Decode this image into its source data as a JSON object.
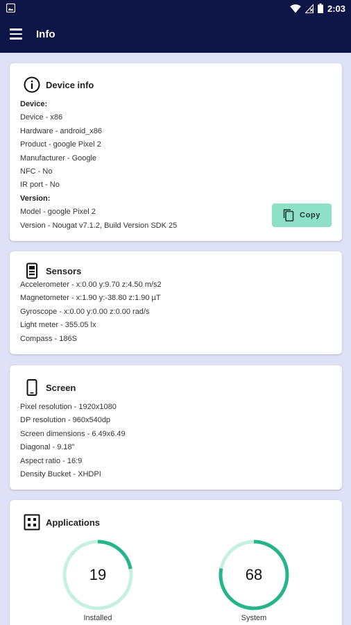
{
  "status_bar": {
    "time": "2:03"
  },
  "app_bar": {
    "title": "Info"
  },
  "device_info": {
    "title": "Device info",
    "lines": [
      {
        "text": "Device:",
        "bold": true
      },
      {
        "text": "Device - x86",
        "bold": false
      },
      {
        "text": "Hardware - android_x86",
        "bold": false
      },
      {
        "text": "Product - google Pixel 2",
        "bold": false
      },
      {
        "text": "Manufacturer - Google",
        "bold": false
      },
      {
        "text": "NFC - No",
        "bold": false
      },
      {
        "text": "IR port - No",
        "bold": false
      },
      {
        "text": "Version:",
        "bold": true
      },
      {
        "text": "Model - google Pixel 2",
        "bold": false
      },
      {
        "text": "Version - Nougat v7.1.2, Build Version SDK 25",
        "bold": false
      }
    ],
    "copy_label": "Copy"
  },
  "sensors": {
    "title": "Sensors",
    "lines": [
      "Accelerometer - x:0.00 y:9.70 z:4.50 m/s2",
      "Magnetometer - x:1.90 y:-38.80 z:1.90 µT",
      "Gyroscope - x:0.00 y:0.00 z:0.00 rad/s",
      "Light meter - 355.05 lx",
      "Compass - 186S"
    ]
  },
  "screen": {
    "title": "Screen",
    "lines": [
      "Pixel resolution - 1920x1080",
      "DP resolution - 960x540dp",
      "Screen dimensions - 6.49x6.49",
      "Diagonal - 9.18\"",
      "Aspect ratio - 16:9",
      "Density Bucket - XHDPI"
    ]
  },
  "applications": {
    "title": "Applications",
    "installed": {
      "value": "19",
      "label": "Installed",
      "fraction": 0.22
    },
    "system": {
      "value": "68",
      "label": "System",
      "fraction": 0.78
    }
  },
  "colors": {
    "app_bar": "#0d1446",
    "accent": "#26b58a",
    "accent_light": "#c6f0e2",
    "button": "#8ee0c7"
  }
}
